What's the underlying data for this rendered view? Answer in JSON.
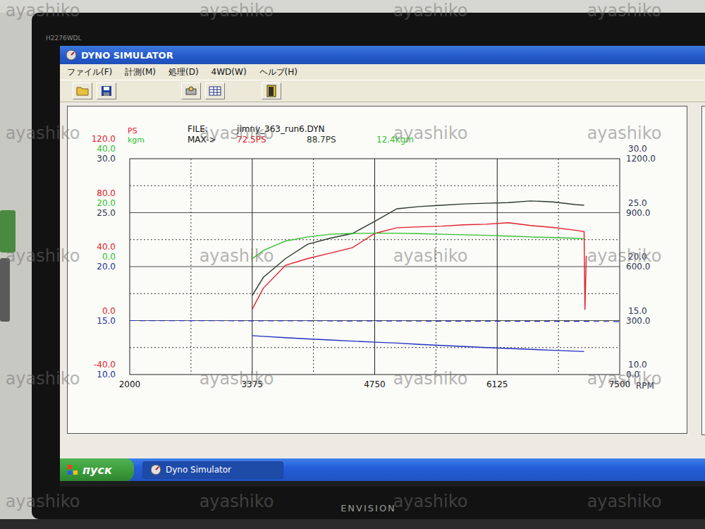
{
  "monitor": {
    "model": "H2276WDL",
    "brand": "ENVISION"
  },
  "window": {
    "title": "DYNO SIMULATOR"
  },
  "menu": [
    "ファイル(F)",
    "計測(M)",
    "処理(D)",
    "4WD(W)",
    "ヘルプ(H)"
  ],
  "chart": {
    "legend": [
      {
        "text": "PS",
        "color": "#e0202a"
      },
      {
        "text": "kgm",
        "color": "#30c030"
      }
    ],
    "file_label": "FILE:",
    "file": "jimny_363_run6.DYN",
    "max_label": "MAX->",
    "max_values": [
      {
        "text": "72.5PS",
        "color": "#e0202a"
      },
      {
        "text": "88.7PS",
        "color": "#2d3a2d"
      },
      {
        "text": "12.4kgm",
        "color": "#30c030"
      }
    ],
    "left_axis": [
      [
        {
          "text": "120.0",
          "color": "#e0202a"
        },
        {
          "text": "40.0",
          "color": "#30c030"
        },
        {
          "text": "30.0",
          "color": "#2b3550"
        }
      ],
      [
        {
          "text": "80.0",
          "color": "#e0202a"
        },
        {
          "text": "20.0",
          "color": "#30c030"
        },
        {
          "text": "25.0",
          "color": "#2b3550"
        }
      ],
      [
        {
          "text": "40.0",
          "color": "#e0202a"
        },
        {
          "text": "0.0",
          "color": "#30c030"
        },
        {
          "text": "20.0",
          "color": "#2030a0"
        }
      ],
      [
        {
          "text": "0.0",
          "color": "#e0202a"
        },
        {
          "text": "15.0",
          "color": "#2030a0"
        }
      ],
      [
        {
          "text": "-40.0",
          "color": "#e0202a"
        },
        {
          "text": "10.0",
          "color": "#2030a0"
        }
      ]
    ],
    "right_axis": [
      [
        "30.0",
        "1200.0"
      ],
      [
        "25.0",
        "900.0"
      ],
      [
        "20.0",
        "600.0"
      ],
      [
        "15.0",
        "300.0"
      ],
      [
        "10.0",
        "0.0"
      ]
    ],
    "x_axis": [
      "2000",
      "3375",
      "4750",
      "6125",
      "7500"
    ],
    "x_unit": "RPM",
    "series": [
      {
        "color": "#2d3a2d",
        "kind": "solid",
        "rpm": [
          3375,
          3500,
          3750,
          4000,
          4250,
          4500,
          4750,
          5000,
          5250,
          5500,
          5750,
          6000,
          6250,
          6500,
          6750,
          7000,
          7100
        ],
        "values": [
          18.6,
          32,
          46,
          56.7,
          61,
          64.6,
          73.5,
          82.9,
          84.5,
          85.5,
          86.5,
          87,
          87.5,
          88.7,
          88,
          86,
          85.5
        ]
      },
      {
        "color": "#e0202a",
        "kind": "solid",
        "rpm": [
          3375,
          3500,
          3750,
          4000,
          4250,
          4500,
          4750,
          5000,
          5250,
          5500,
          5750,
          6000,
          6250,
          6500,
          6750,
          7000,
          7100,
          7110,
          7125
        ],
        "values": [
          8.6,
          24,
          41,
          46,
          50,
          54,
          64.6,
          68.8,
          69.5,
          70,
          71,
          71.4,
          72.5,
          70.5,
          69,
          67,
          66,
          8,
          48
        ]
      },
      {
        "color": "#30c030",
        "kind": "solid",
        "rpm": [
          3375,
          3500,
          3750,
          4000,
          4250,
          4500,
          4750,
          5000,
          5250,
          5500,
          5750,
          6000,
          6250,
          6500,
          6750,
          7000,
          7100
        ],
        "values": [
          2.9,
          6,
          9.5,
          11,
          12,
          12.3,
          12.4,
          12.4,
          12.2,
          12,
          11.8,
          11.6,
          11.3,
          11,
          10.8,
          10.5,
          10.3
        ]
      },
      {
        "color": "#2030c0",
        "kind": "solid",
        "rpm": [
          3375,
          3500,
          3750,
          4000,
          4250,
          4500,
          4750,
          5000,
          5250,
          5500,
          5750,
          6000,
          6250,
          6500,
          6750,
          7000,
          7100
        ],
        "values": [
          216,
          212,
          205,
          198,
          192,
          186,
          180,
          175,
          168,
          162,
          156,
          150,
          145,
          140,
          135,
          130,
          128
        ]
      },
      {
        "color": "#2030c0",
        "kind": "dashed",
        "rpm": [
          2000,
          7500
        ],
        "values": [
          300,
          295
        ]
      }
    ]
  },
  "taskbar": {
    "start": "пуск",
    "tasks": [
      {
        "label": "Dyno Simulator",
        "selected": true
      }
    ]
  },
  "watermarks": [
    "ayashiko",
    "ayashiko",
    "ayashiko",
    "ayashiko",
    "ayashiko",
    "ayashiko",
    "ayashiko",
    "ayashiko",
    "ayashiko",
    "ayashiko",
    "ayashiko",
    "ayashiko",
    "ayashiko",
    "ayashiko",
    "ayashiko",
    "ayashiko",
    "ayashiko",
    "ayashiko",
    "ayashiko",
    "ayashiko"
  ]
}
